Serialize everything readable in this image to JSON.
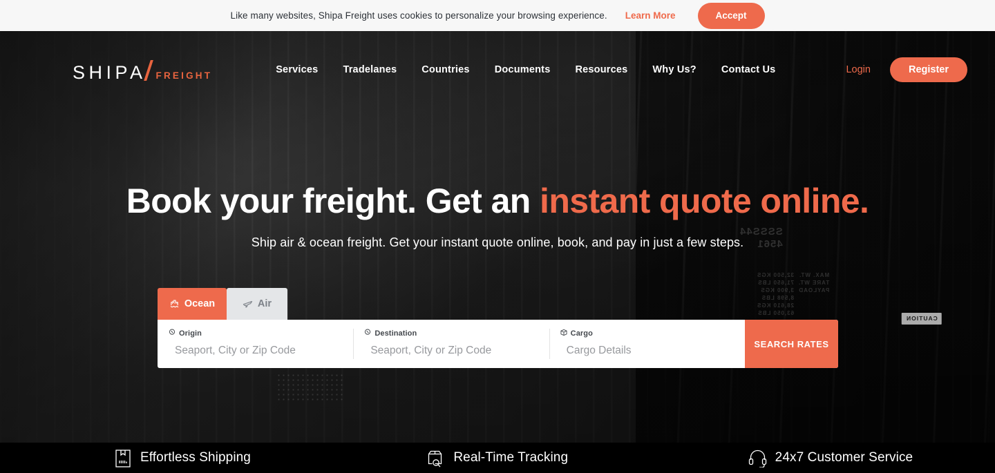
{
  "cookie_bar": {
    "message": "Like many websites, Shipa Freight uses cookies to personalize your browsing experience.",
    "learn_more_label": "Learn More",
    "accept_label": "Accept"
  },
  "header": {
    "logo": {
      "main": "SHIPA",
      "sub": "FREIGHT"
    },
    "nav_items": [
      {
        "label": "Services"
      },
      {
        "label": "Tradelanes"
      },
      {
        "label": "Countries"
      },
      {
        "label": "Documents"
      },
      {
        "label": "Resources"
      },
      {
        "label": "Why Us?"
      },
      {
        "label": "Contact Us"
      }
    ],
    "login_label": "Login",
    "register_label": "Register"
  },
  "hero": {
    "headline_plain": "Book your freight. Get an ",
    "headline_accent": "instant quote online.",
    "subhead": "Ship air & ocean freight. Get your instant quote online, book, and pay in just a few steps.",
    "background_markings": {
      "container_id": "SSSS44\n4561",
      "weights_left": "32,500 KGS\n71,650 LBS\n3,900 KGS\n8,598 LBS\n28,610 KGS\n63,050 LBS",
      "weights_right": "MAX. WT.\nTARE WT.\nPAYLOAD",
      "caution": "CAUTION"
    }
  },
  "search_widget": {
    "tabs": [
      {
        "label": "Ocean",
        "icon": "ship-icon",
        "active": true
      },
      {
        "label": "Air",
        "icon": "plane-icon",
        "active": false
      }
    ],
    "fields": [
      {
        "label": "Origin",
        "icon": "location-pin-icon",
        "value": "",
        "placeholder": "Seaport, City or Zip Code"
      },
      {
        "label": "Destination",
        "icon": "location-pin-icon",
        "value": "",
        "placeholder": "Seaport, City or Zip Code"
      },
      {
        "label": "Cargo",
        "icon": "box-icon",
        "value": "",
        "placeholder": "Cargo Details"
      }
    ],
    "search_button_label": "SEARCH RATES"
  },
  "features": [
    {
      "label": "Effortless Shipping",
      "icon": "package-barcode-icon"
    },
    {
      "label": "Real-Time Tracking",
      "icon": "box-magnifier-icon"
    },
    {
      "label": "24x7 Customer Service",
      "icon": "headset-icon"
    }
  ],
  "colors": {
    "accent": "#ee6a4c",
    "accent_text": "#ef6a4b",
    "cookie_bar_bg": "#f7f7f7",
    "hero_bg_dark": "#1f1f1f",
    "feature_bar_bg": "#000000",
    "tab_inactive_bg": "#e4e6e8"
  }
}
